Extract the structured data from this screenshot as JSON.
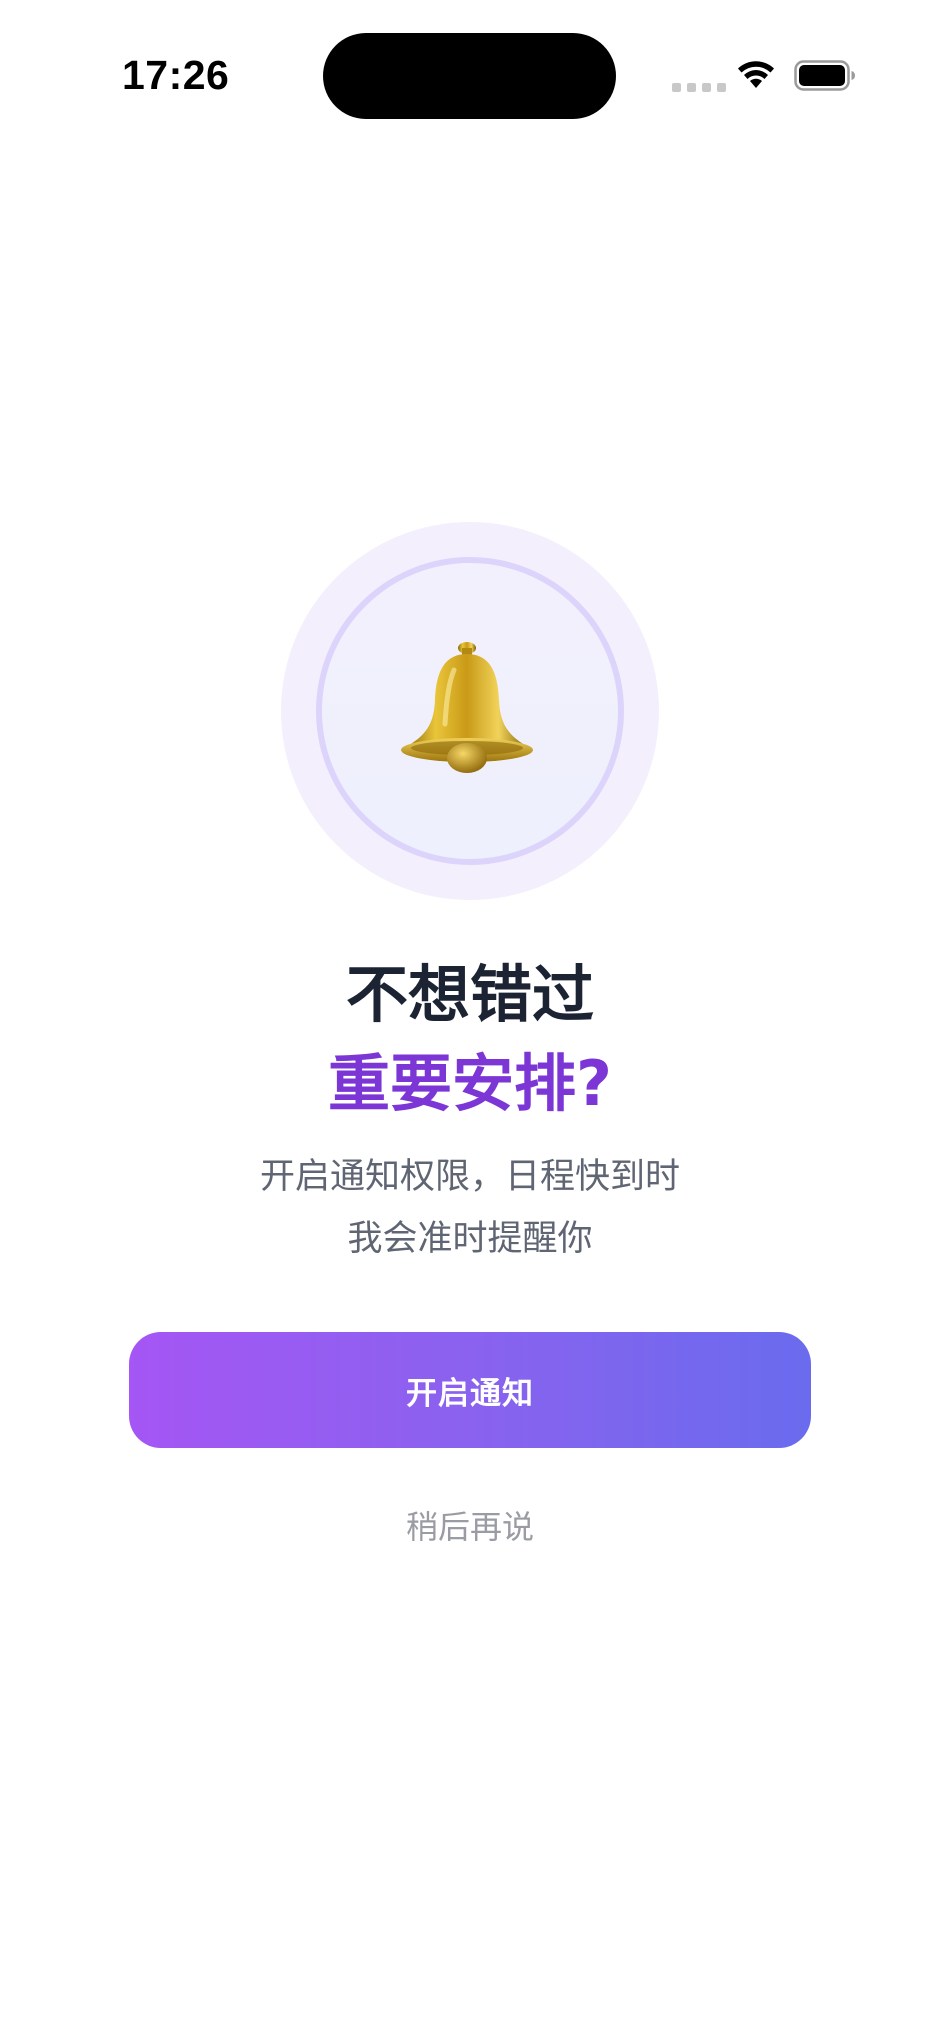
{
  "status_bar": {
    "time": "17:26",
    "icons": [
      "signal-dots-icon",
      "wifi-icon",
      "battery-icon"
    ]
  },
  "illustration": {
    "icon": "bell-icon"
  },
  "headline": {
    "line1": "不想错过",
    "line2": "重要安排?"
  },
  "description": {
    "line1": "开启通知权限，日程快到时",
    "line2": "我会准时提醒你"
  },
  "actions": {
    "enable_label": "开启通知",
    "later_label": "稍后再说"
  },
  "colors": {
    "accent_purple": "#7c36d6",
    "button_gradient_start": "#a556f4",
    "button_gradient_end": "#6a6bee",
    "title_dark": "#1c2433",
    "body_gray": "#5f6573",
    "muted_gray": "#9a9ca3"
  }
}
